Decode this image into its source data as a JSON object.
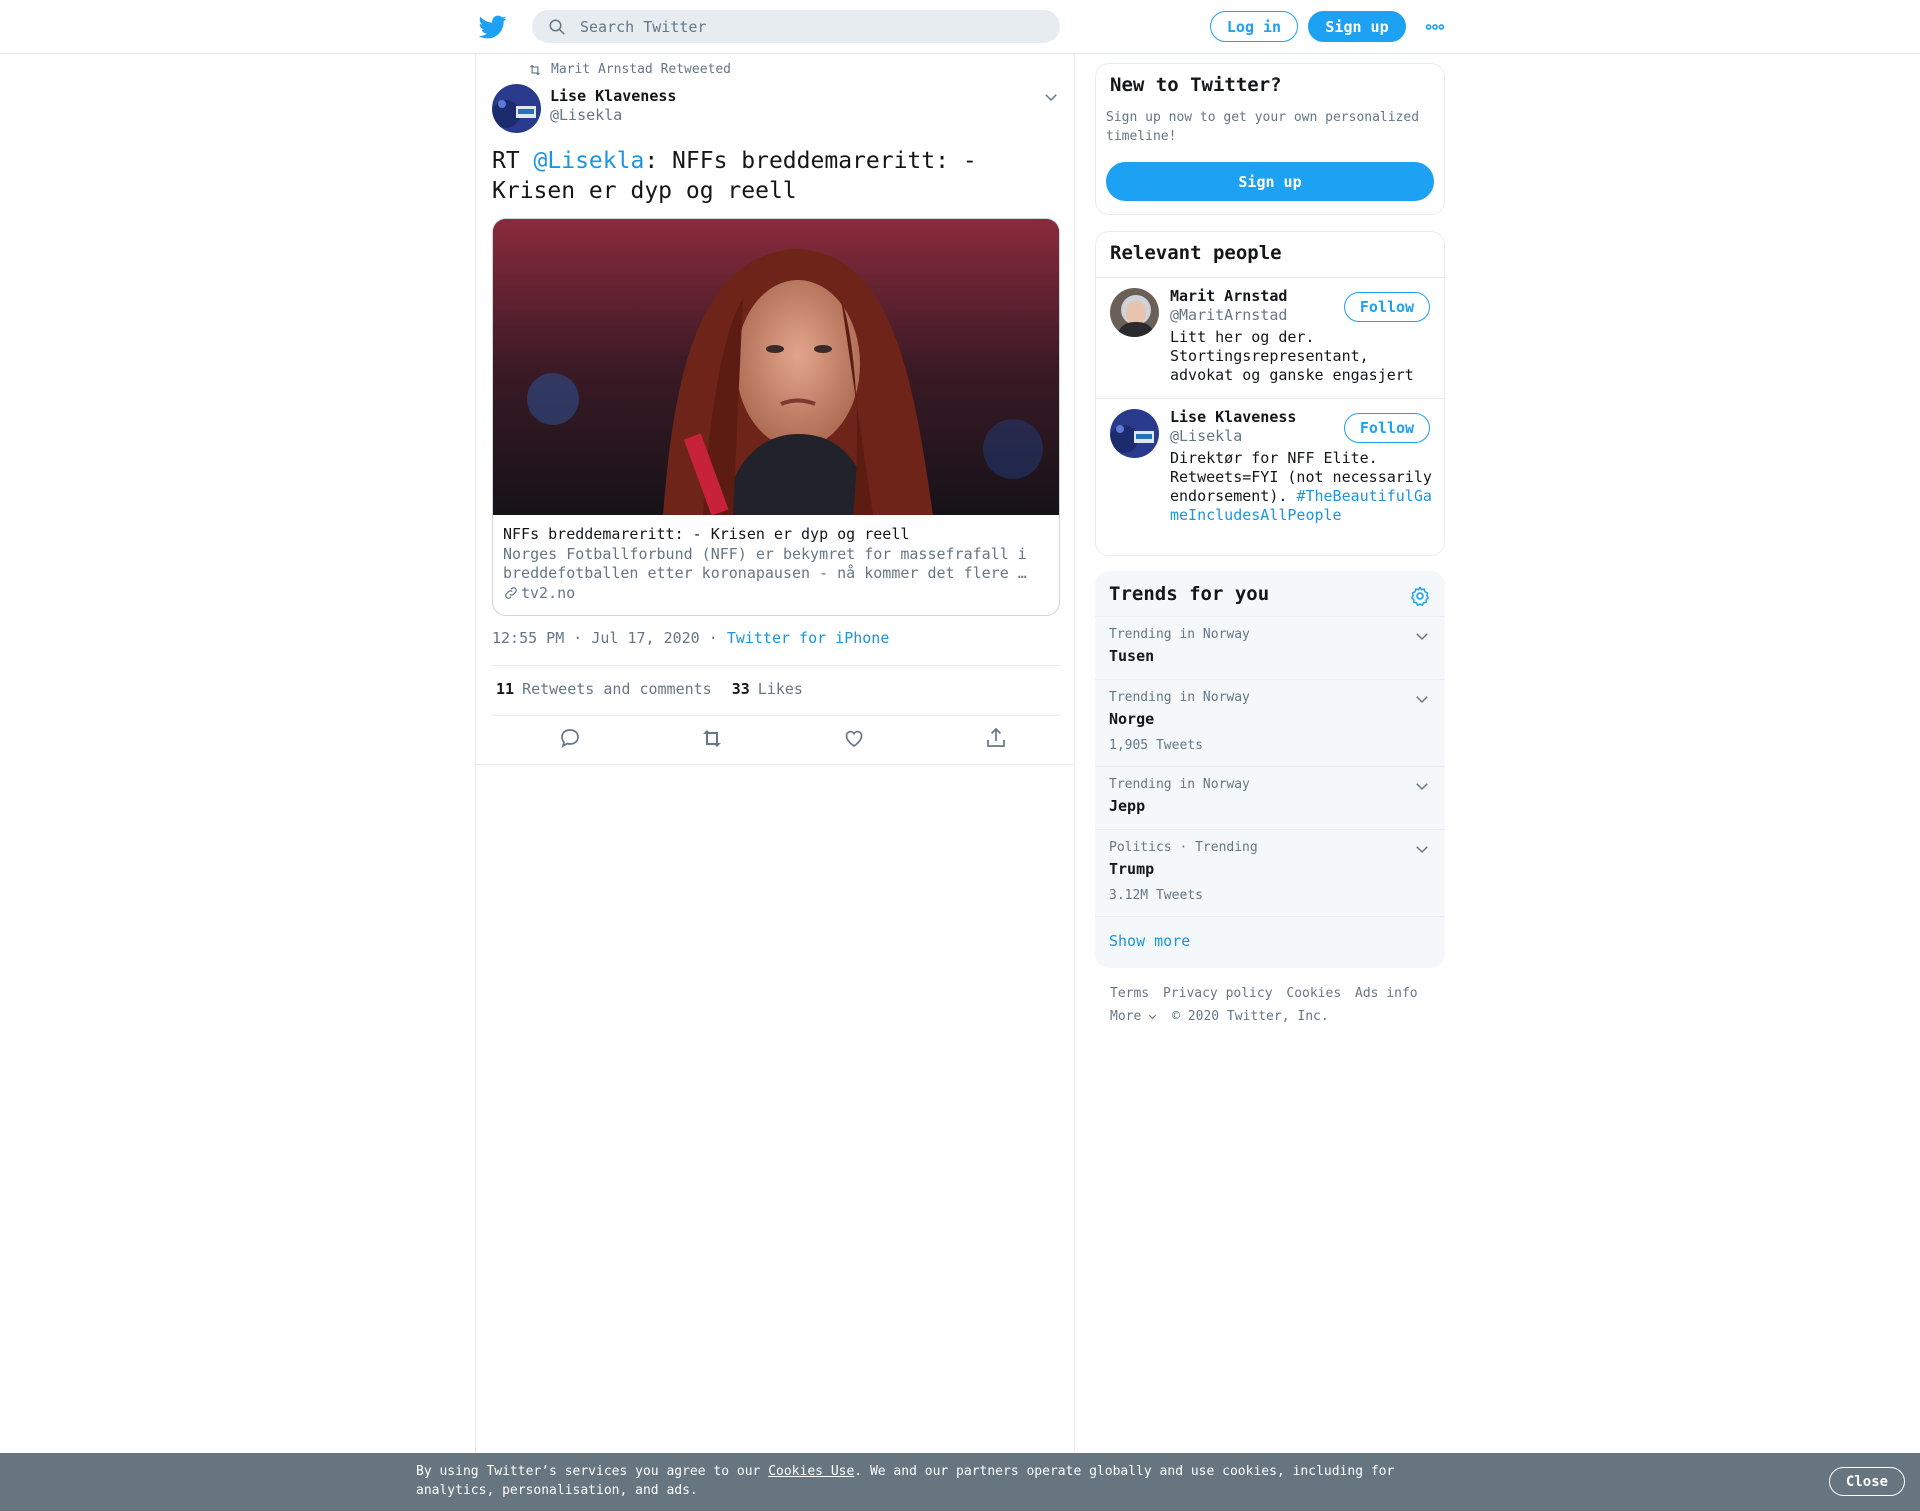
{
  "header": {
    "search_placeholder": "Search Twitter",
    "login_label": "Log in",
    "signup_label": "Sign up"
  },
  "tweet": {
    "retweeted_by": "Marit Arnstad Retweeted",
    "author_name": "Lise Klaveness",
    "author_handle": "@Lisekla",
    "text_prefix": "RT ",
    "text_mention": "@Lisekla",
    "text_body": ": NFFs breddemareritt: - Krisen er dyp og reell",
    "card": {
      "title": "NFFs breddemareritt: - Krisen er dyp og reell",
      "description": "Norges Fotballforbund (NFF) er bekymret for massefrafall i breddefotballen etter koronapausen - nå kommer det flere …",
      "domain": "tv2.no"
    },
    "time": "12:55 PM · Jul 17, 2020",
    "source_sep": "·",
    "source": "Twitter for iPhone",
    "retweets_count": "11",
    "retweets_label": "Retweets and comments",
    "likes_count": "33",
    "likes_label": "Likes"
  },
  "sidebar": {
    "new_title": "New to Twitter?",
    "new_text": "Sign up now to get your own personalized timeline!",
    "new_signup": "Sign up",
    "people_title": "Relevant people",
    "people": [
      {
        "name": "Marit Arnstad",
        "handle": "@MaritArnstad",
        "bio": "Litt her og der. Stortingsrepresentant, advokat og ganske engasjert",
        "follow": "Follow"
      },
      {
        "name": "Lise Klaveness",
        "handle": "@Lisekla",
        "bio": "Direktør for NFF Elite. Retweets=FYI (not necessarily endorsement).",
        "hashtag": "#TheBeautifulGameIncludesAllPeople",
        "follow": "Follow"
      }
    ],
    "trends_title": "Trends for you",
    "trends": [
      {
        "context": "Trending in Norway",
        "name": "Tusen",
        "count": ""
      },
      {
        "context": "Trending in Norway",
        "name": "Norge",
        "count": "1,905 Tweets"
      },
      {
        "context": "Trending in Norway",
        "name": "Jepp",
        "count": ""
      },
      {
        "context": "Politics · Trending",
        "name": "Trump",
        "count": "3.12M Tweets"
      }
    ],
    "show_more": "Show more",
    "footer": {
      "terms": "Terms",
      "privacy": "Privacy policy",
      "cookies": "Cookies",
      "ads": "Ads info",
      "more": "More",
      "copyright": "© 2020 Twitter, Inc."
    }
  },
  "cookie_banner": {
    "text_before": "By using Twitter’s services you agree to our ",
    "link": "Cookies Use",
    "text_after": ". We and our partners operate globally and use cookies, including for analytics, personalisation, and ads.",
    "close": "Close"
  },
  "colors": {
    "accent": "#1da1f2",
    "link": "#1b95e0",
    "muted": "#657786",
    "banner": "#66757f"
  }
}
